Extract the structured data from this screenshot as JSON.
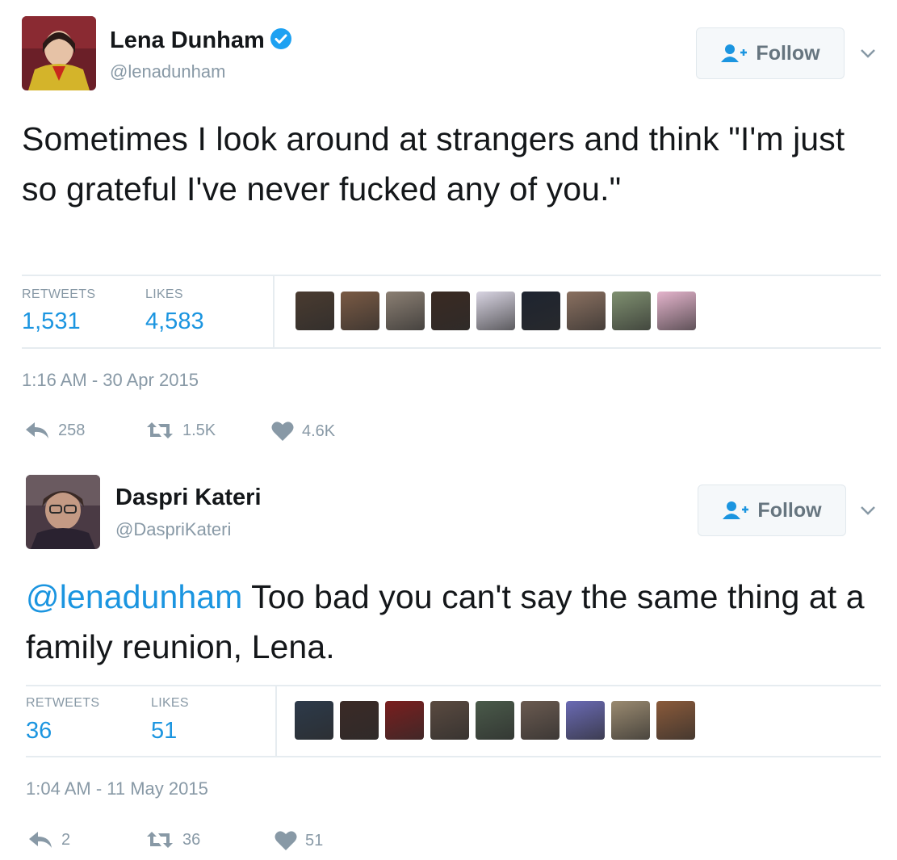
{
  "tweets": [
    {
      "name": "Lena Dunham",
      "handle": "@lenadunham",
      "verified": true,
      "follow_label": "Follow",
      "text": "Sometimes I look around at strangers and think \"I'm just so grateful I've never fucked any of you.\"",
      "retweets_label": "RETWEETS",
      "retweets": "1,531",
      "likes_label": "LIKES",
      "likes": "4,583",
      "timestamp": "1:16 AM - 30 Apr 2015",
      "reply_count": "258",
      "retweet_count": "1.5K",
      "like_count": "4.6K",
      "liker_colors": [
        "#4a3b30",
        "#7a5a44",
        "#8b7f73",
        "#3a2a22",
        "#d8d4e2",
        "#1e2430",
        "#8a7060",
        "#7f9070",
        "#e4b4cc"
      ]
    },
    {
      "name": "Daspri Kateri",
      "handle": "@DaspriKateri",
      "verified": false,
      "follow_label": "Follow",
      "mention": "@lenadunham",
      "text": " Too bad you can't say the same thing at a family reunion, Lena.",
      "retweets_label": "RETWEETS",
      "retweets": "36",
      "likes_label": "LIKES",
      "likes": "51",
      "timestamp": "1:04 AM - 11 May 2015",
      "reply_count": "2",
      "retweet_count": "36",
      "like_count": "51",
      "liker_colors": [
        "#2d3a4a",
        "#3b2a26",
        "#7a1e1e",
        "#5a4a40",
        "#4a5a4a",
        "#6a5a50",
        "#6a6ab4",
        "#9a8a70",
        "#8a5a3a"
      ]
    }
  ],
  "colors": {
    "accent": "#1b95e0",
    "verified": "#1da1f2",
    "muted": "#8899a6",
    "text": "#14171a"
  }
}
